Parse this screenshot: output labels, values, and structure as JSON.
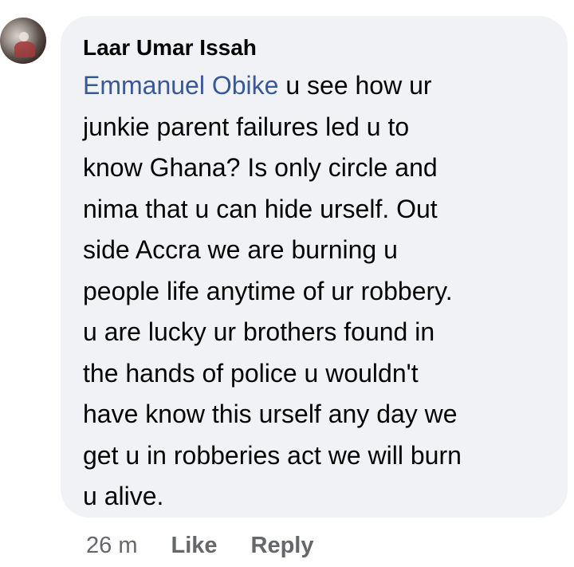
{
  "comment": {
    "author": "Laar Umar Issah",
    "mention": "Emmanuel Obike",
    "text": " u see how ur\njunkie parent failures led u to\nknow Ghana? Is only circle and\nnima that u can hide urself. Out\nside Accra we are burning u\npeople life anytime of ur robbery.\nu are lucky ur brothers found in\nthe hands of police u wouldn't\nhave know this urself any day we\nget u in robberies act we will burn\nu alive.",
    "time": "26 m",
    "actions": {
      "like": "Like",
      "reply": "Reply"
    }
  },
  "colors": {
    "bubble_bg": "#f0f2f5",
    "mention": "#385898",
    "meta": "#65676b",
    "text": "#050505"
  }
}
